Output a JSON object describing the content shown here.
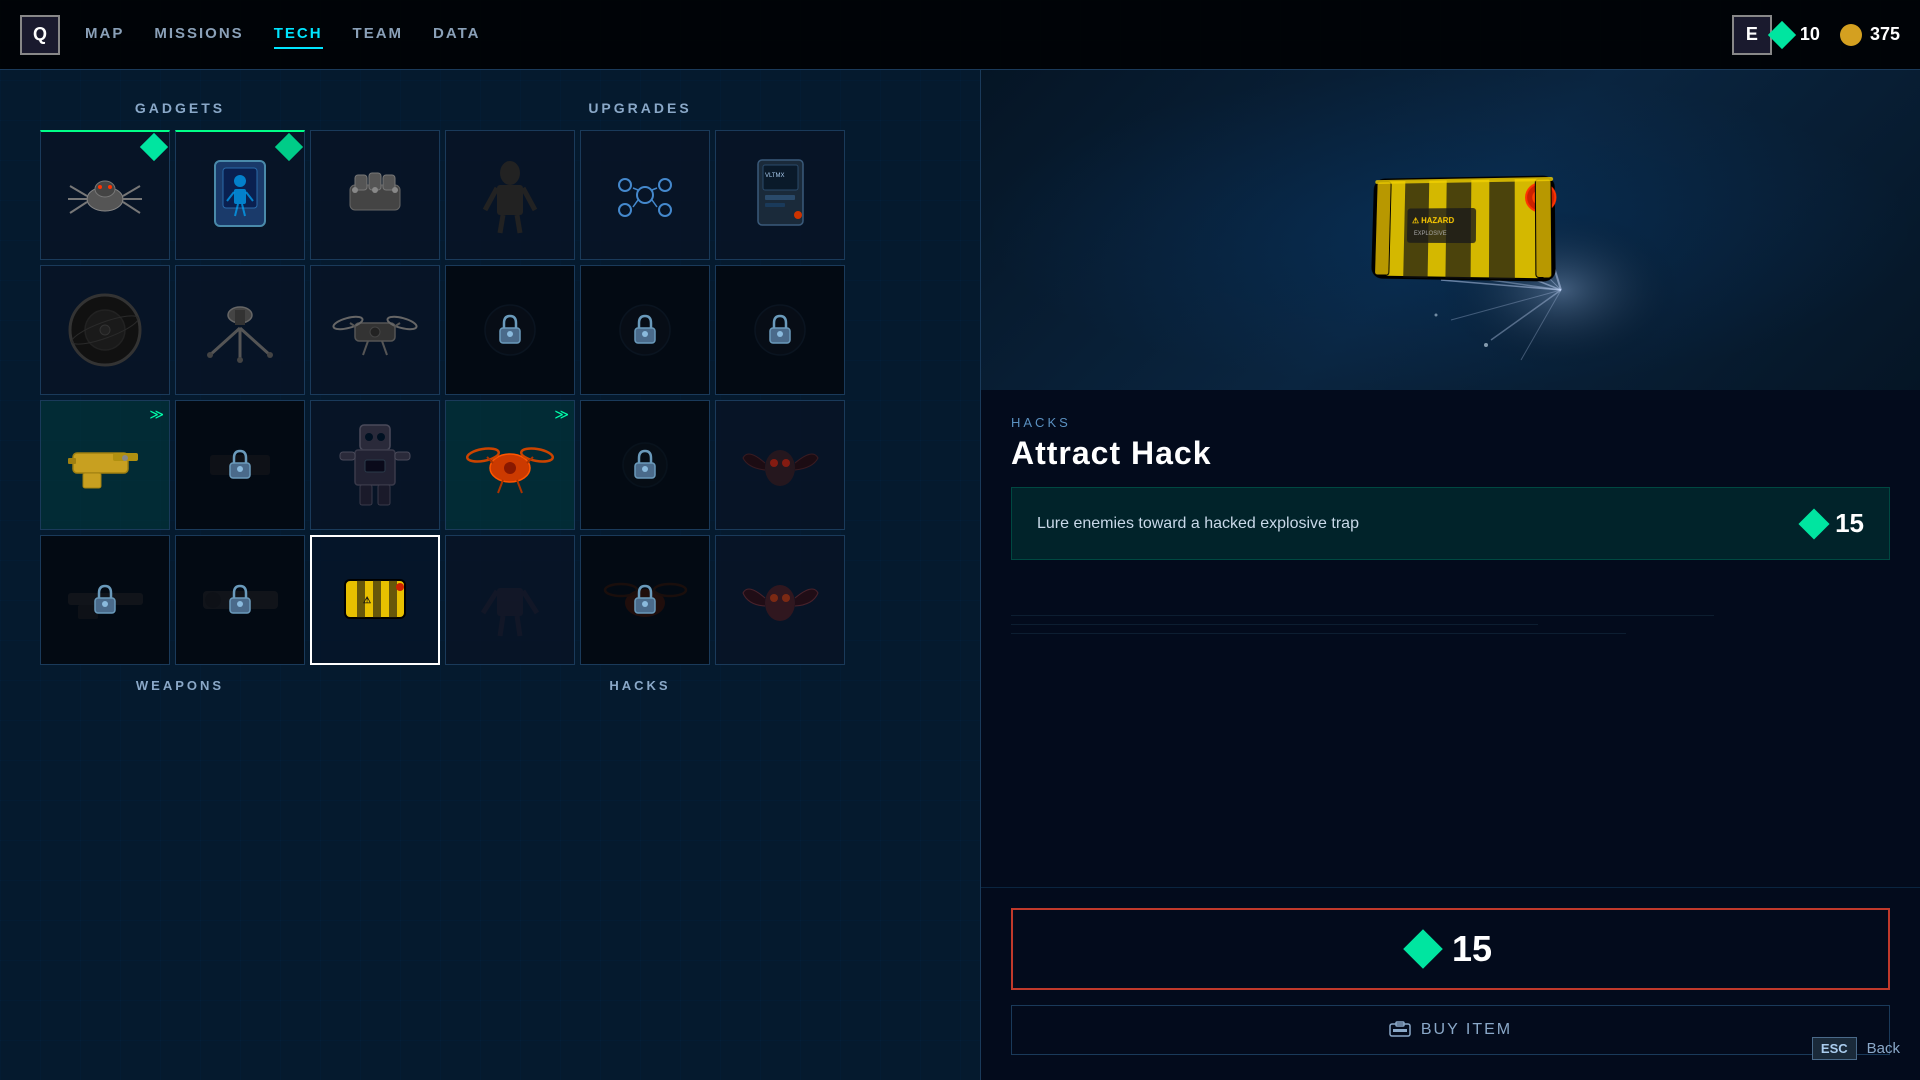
{
  "nav": {
    "q_label": "Q",
    "e_label": "E",
    "items": [
      {
        "label": "MAP",
        "active": false
      },
      {
        "label": "MISSIONS",
        "active": false
      },
      {
        "label": "TECH",
        "active": true
      },
      {
        "label": "TEAM",
        "active": false
      },
      {
        "label": "DATA",
        "active": false
      }
    ],
    "currency_diamond": "10",
    "currency_coin": "375"
  },
  "sections": {
    "gadgets_label": "GADGETS",
    "upgrades_label": "UPGRADES",
    "weapons_label": "WEAPONS",
    "hacks_label": "HACKS"
  },
  "detail": {
    "category": "HACKS",
    "item_name": "Attract Hack",
    "description": "Lure enemies toward a hacked explosive trap",
    "cost": "15",
    "buy_price": "15",
    "buy_label": "Buy Item"
  },
  "footer": {
    "esc_label": "ESC",
    "back_label": "Back"
  },
  "icons": {
    "diamond": "◆",
    "lock": "🔒",
    "equip_arrows": "⋙",
    "buy_icon": "🖨"
  }
}
